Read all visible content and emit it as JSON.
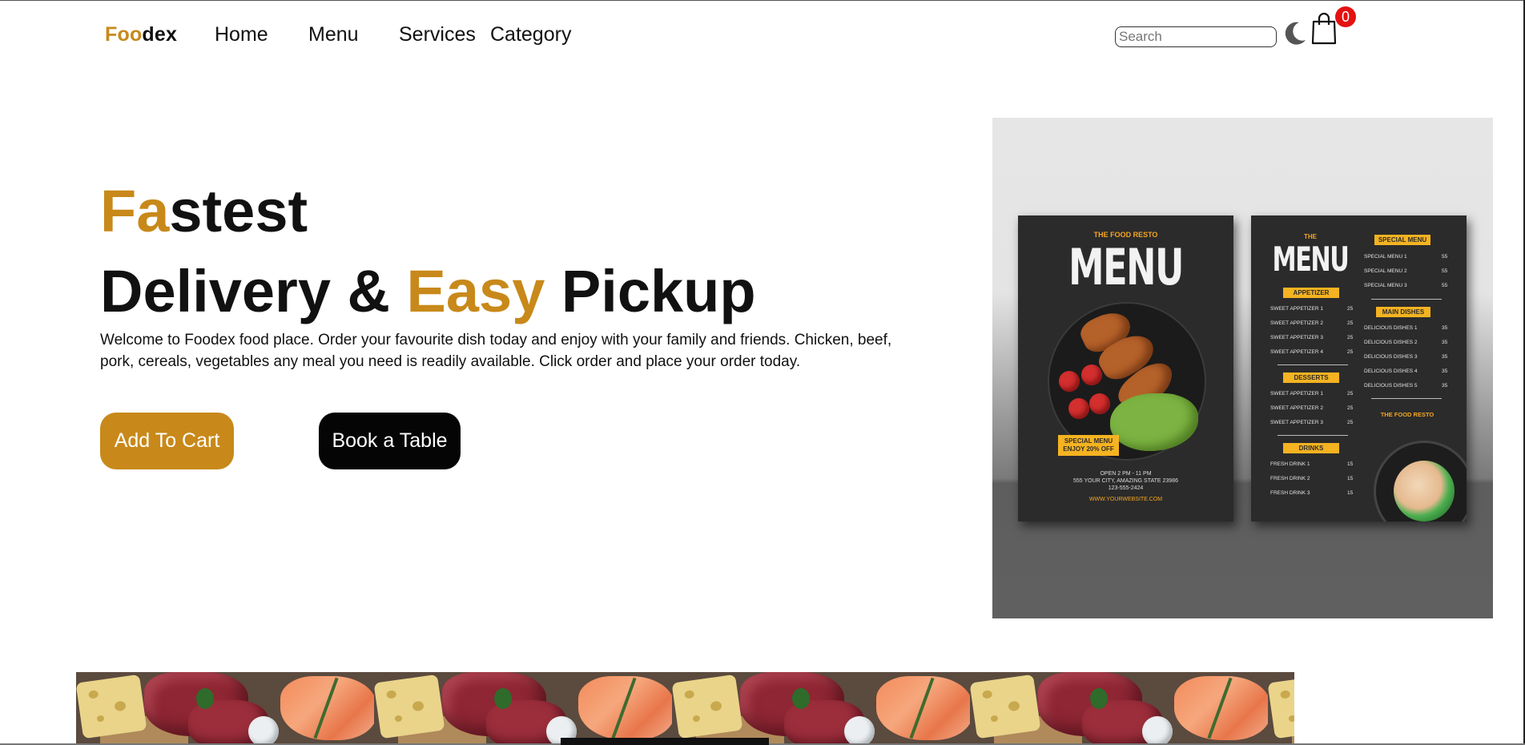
{
  "nav": {
    "logo_part1": "Foo",
    "logo_part2": "de",
    "logo_part3": "x",
    "links": [
      "Home",
      "Menu",
      "Services",
      "Category"
    ],
    "search_placeholder": "Search",
    "theme_icon": "moon-icon",
    "cart_icon": "shopping-bag-icon",
    "cart_count": "0"
  },
  "hero": {
    "title_line1_accent": "Fa",
    "title_line1_rest": "stest",
    "title_line2_part1": "Delivery & ",
    "title_line2_accent": "Easy",
    "title_line2_part2": " Pickup",
    "description": "Welcome to Foodex food place. Order your favourite dish today and enjoy with your family and friends. Chicken, beef, pork, cereals, vegetables any meal you need is readily available. Click order and place your order today.",
    "add_to_cart_label": "Add To Cart",
    "book_table_label": "Book a Table"
  },
  "menu_image": {
    "left_card": {
      "brand": "THE FOOD RESTO",
      "title": "MENU",
      "special_tag_line1": "SPECIAL MENU",
      "special_tag_line2": "ENJOY 20% OFF",
      "hours": "OPEN 2 PM - 11 PM",
      "address": "555 YOUR CITY, AMAZING STATE 23986",
      "phone": "123-555-2424",
      "url": "WWW.YOURWEBSITE.COM"
    },
    "right_card": {
      "the": "THE",
      "title": "MENU",
      "special_menu_header": "SPECIAL MENU",
      "special_items": [
        {
          "name": "SPECIAL MENU 1",
          "price": "55"
        },
        {
          "name": "SPECIAL MENU 2",
          "price": "55"
        },
        {
          "name": "SPECIAL MENU 3",
          "price": "55"
        }
      ],
      "appetizer_header": "APPETIZER",
      "appetizers": [
        {
          "name": "SWEET APPETIZER 1",
          "price": "25"
        },
        {
          "name": "SWEET APPETIZER 2",
          "price": "25"
        },
        {
          "name": "SWEET APPETIZER 3",
          "price": "25"
        },
        {
          "name": "SWEET APPETIZER 4",
          "price": "25"
        }
      ],
      "main_header": "MAIN DISHES",
      "mains": [
        {
          "name": "DELICIOUS DISHES 1",
          "price": "35"
        },
        {
          "name": "DELICIOUS DISHES 2",
          "price": "35"
        },
        {
          "name": "DELICIOUS DISHES 3",
          "price": "35"
        },
        {
          "name": "DELICIOUS DISHES 4",
          "price": "35"
        },
        {
          "name": "DELICIOUS DISHES 5",
          "price": "35"
        }
      ],
      "desserts_header": "DESSERTS",
      "desserts": [
        {
          "name": "SWEET APPETIZER 1",
          "price": "25"
        },
        {
          "name": "SWEET APPETIZER 2",
          "price": "25"
        },
        {
          "name": "SWEET APPETIZER 3",
          "price": "25"
        }
      ],
      "resto_label": "THE FOOD RESTO",
      "drinks_header": "DRINKS",
      "drinks": [
        {
          "name": "FRESH DRINK 1",
          "price": "15"
        },
        {
          "name": "FRESH DRINK 2",
          "price": "15"
        },
        {
          "name": "FRESH DRINK 3",
          "price": "15"
        }
      ]
    }
  },
  "colors": {
    "accent": "#c8891a",
    "dark_button": "#050505",
    "badge": "#e41111"
  }
}
